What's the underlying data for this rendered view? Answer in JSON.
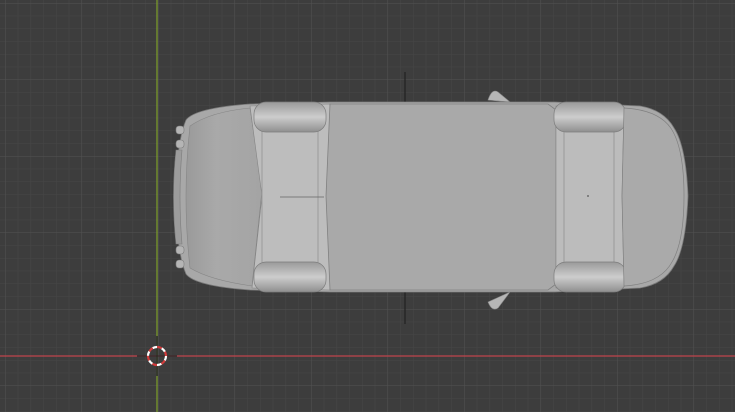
{
  "viewport": {
    "view": "top-orthographic",
    "background_color": "#3d3d3d",
    "grid_minor_color": "#464646",
    "grid_major_color": "#525252",
    "x_axis_color": "#c0444c",
    "y_axis_color": "#7fa12a",
    "cursor_icon": "3d-cursor-icon",
    "model_color": "#a7a7a7",
    "model": "car-mesh"
  }
}
